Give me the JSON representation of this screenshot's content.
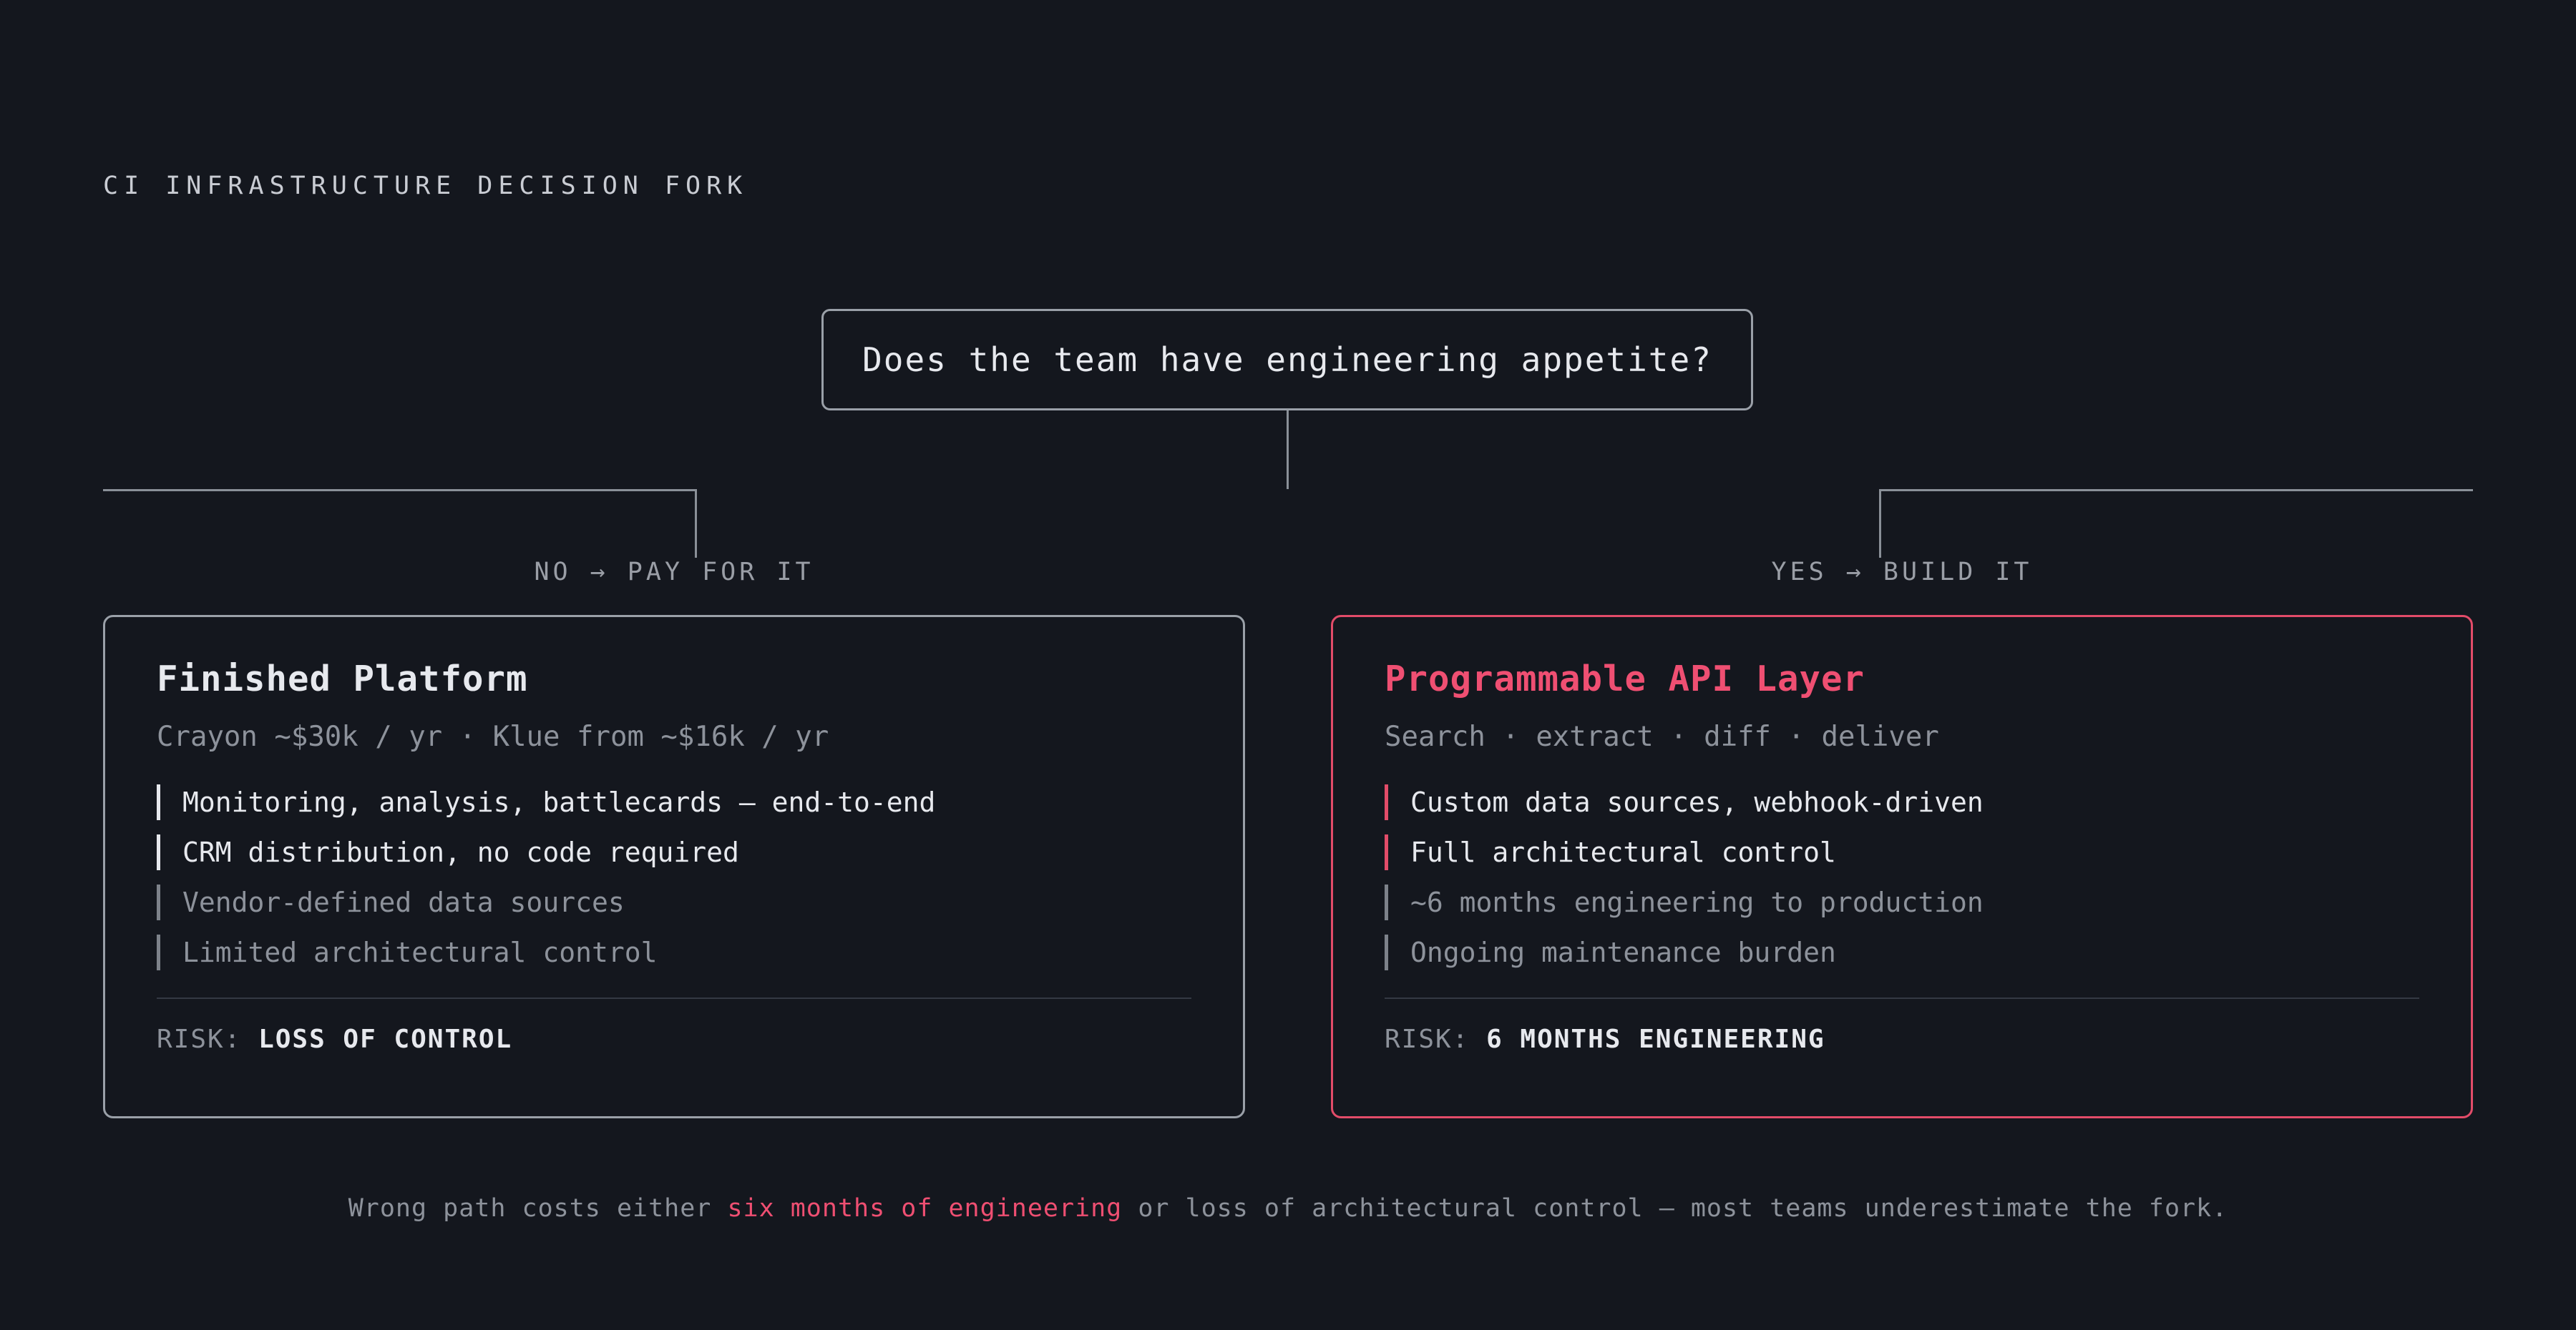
{
  "eyebrow": "CI INFRASTRUCTURE DECISION FORK",
  "question": "Does the team have engineering appetite?",
  "branches": {
    "left": {
      "label": "NO → PAY FOR IT"
    },
    "right": {
      "label": "YES → BUILD IT"
    }
  },
  "cards": {
    "left": {
      "title": "Finished Platform",
      "subtitle": "Crayon ~$30k / yr · Klue from ~$16k / yr",
      "pros": [
        "Monitoring, analysis, battlecards — end-to-end",
        "CRM distribution, no code required"
      ],
      "cons": [
        "Vendor-defined data sources",
        "Limited architectural control"
      ],
      "risk_label": "RISK:",
      "risk_value": "LOSS OF CONTROL"
    },
    "right": {
      "title": "Programmable API Layer",
      "subtitle": "Search · extract · diff · deliver",
      "pros": [
        "Custom data sources, webhook-driven",
        "Full architectural control"
      ],
      "cons": [
        "~6 months engineering to production",
        "Ongoing maintenance burden"
      ],
      "risk_label": "RISK:",
      "risk_value": "6 MONTHS ENGINEERING"
    }
  },
  "footnote": {
    "before": "Wrong path costs either ",
    "highlight": "six months of engineering",
    "after": " or loss of architectural control — most teams underestimate the fork."
  },
  "colors": {
    "background": "#14171e",
    "accent": "#ef4f72",
    "border": "#9aa0a8"
  }
}
